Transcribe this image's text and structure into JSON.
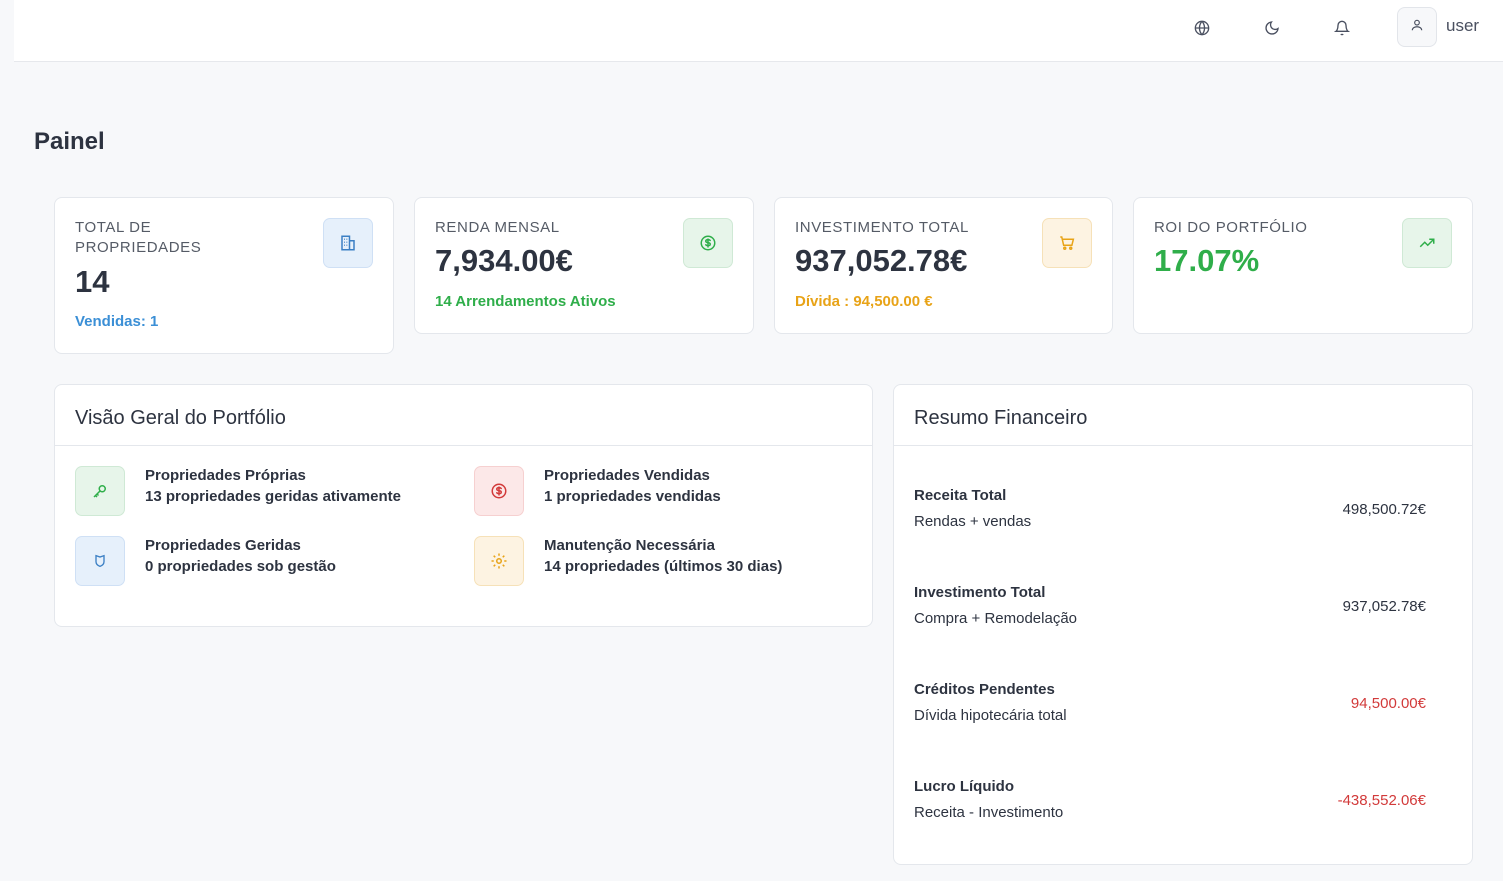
{
  "header": {
    "username": "user",
    "icons": [
      "globe-icon",
      "moon-icon",
      "bell-icon",
      "user-icon"
    ]
  },
  "page": {
    "title": "Painel"
  },
  "stats": [
    {
      "label": "TOTAL DE PROPRIEDADES",
      "value": "14",
      "sub": "Vendidas: 1",
      "sub_color": "#3b8fd6",
      "icon": "building-icon",
      "icon_bg": "#e6f0fb",
      "icon_color": "#3b7fc4"
    },
    {
      "label": "RENDA MENSAL",
      "value": "7,934.00€",
      "sub": "14 Arrendamentos Ativos",
      "sub_color": "#2fae4a",
      "icon": "dollar-circle-icon",
      "icon_bg": "#e7f5ea",
      "icon_color": "#2fae4a"
    },
    {
      "label": "INVESTIMENTO TOTAL",
      "value": "937,052.78€",
      "sub": "Dívida : 94,500.00 €",
      "sub_color": "#e8a317",
      "icon": "cart-icon",
      "icon_bg": "#fdf3e2",
      "icon_color": "#e8a317"
    },
    {
      "label": "ROI DO PORTFÓLIO",
      "value": "17.07%",
      "value_color": "#2fae4a",
      "icon": "trending-up-icon",
      "icon_bg": "#e7f5ea",
      "icon_color": "#2fae4a"
    }
  ],
  "overview": {
    "title": "Visão Geral do Portfólio",
    "items": [
      {
        "title": "Propriedades Próprias",
        "desc": "13 propriedades geridas ativamente",
        "icon": "key-icon",
        "icon_bg": "#e7f5ea",
        "icon_color": "#2fae4a"
      },
      {
        "title": "Propriedades Vendidas",
        "desc": "1 propriedades vendidas",
        "icon": "dollar-circle-icon",
        "icon_bg": "#fce8e8",
        "icon_color": "#d23a3a"
      },
      {
        "title": "Propriedades Geridas",
        "desc": "0 propriedades sob gestão",
        "icon": "shield-icon",
        "icon_bg": "#e6f0fb",
        "icon_color": "#3b7fc4"
      },
      {
        "title": "Manutenção Necessária",
        "desc": "14 propriedades (últimos 30 dias)",
        "icon": "gear-icon",
        "icon_bg": "#fdf3e2",
        "icon_color": "#e8a317"
      }
    ]
  },
  "financial": {
    "title": "Resumo Financeiro",
    "rows": [
      {
        "label": "Receita Total",
        "desc": "Rendas + vendas",
        "value": "498,500.72€",
        "color": "#2d3340"
      },
      {
        "label": "Investimento Total",
        "desc": "Compra + Remodelação",
        "value": "937,052.78€",
        "color": "#2d3340"
      },
      {
        "label": "Créditos Pendentes",
        "desc": "Dívida hipotecária total",
        "value": "94,500.00€",
        "color": "#d23a3a"
      },
      {
        "label": "Lucro Líquido",
        "desc": "Receita - Investimento",
        "value": "-438,552.06€",
        "color": "#d23a3a"
      }
    ]
  }
}
